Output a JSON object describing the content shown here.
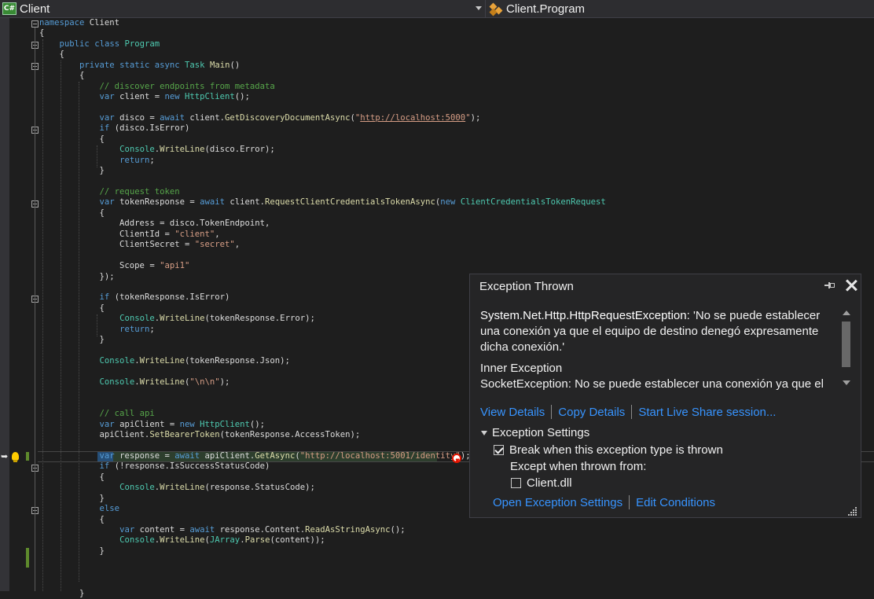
{
  "navbar": {
    "project_icon_label": "C#",
    "project": "Client",
    "member": "Client.Program"
  },
  "code_lines": [
    {
      "segs": [
        [
          "kw",
          "namespace"
        ],
        [
          "t",
          " Client"
        ]
      ]
    },
    {
      "segs": [
        [
          "t",
          "{"
        ]
      ]
    },
    {
      "segs": [
        [
          "t",
          "    "
        ],
        [
          "kw",
          "public"
        ],
        [
          "t",
          " "
        ],
        [
          "kw",
          "class"
        ],
        [
          "t",
          " "
        ],
        [
          "ty",
          "Program"
        ]
      ]
    },
    {
      "segs": [
        [
          "t",
          "    {"
        ]
      ]
    },
    {
      "segs": [
        [
          "t",
          "        "
        ],
        [
          "kw",
          "private"
        ],
        [
          "t",
          " "
        ],
        [
          "kw",
          "static"
        ],
        [
          "t",
          " "
        ],
        [
          "kw",
          "async"
        ],
        [
          "t",
          " "
        ],
        [
          "ty",
          "Task"
        ],
        [
          "t",
          " "
        ],
        [
          "fn",
          "Main"
        ],
        [
          "t",
          "()"
        ]
      ]
    },
    {
      "segs": [
        [
          "t",
          "        {"
        ]
      ]
    },
    {
      "segs": [
        [
          "t",
          "            "
        ],
        [
          "cm",
          "// discover endpoints from metadata"
        ]
      ]
    },
    {
      "segs": [
        [
          "t",
          "            "
        ],
        [
          "kw",
          "var"
        ],
        [
          "t",
          " client = "
        ],
        [
          "kw",
          "new"
        ],
        [
          "t",
          " "
        ],
        [
          "ty",
          "HttpClient"
        ],
        [
          "t",
          "();"
        ]
      ]
    },
    {
      "segs": [
        [
          "t",
          ""
        ]
      ]
    },
    {
      "segs": [
        [
          "t",
          "            "
        ],
        [
          "kw",
          "var"
        ],
        [
          "t",
          " disco = "
        ],
        [
          "kw",
          "await"
        ],
        [
          "t",
          " client."
        ],
        [
          "fn",
          "GetDiscoveryDocumentAsync"
        ],
        [
          "t",
          "("
        ],
        [
          "st",
          "\""
        ],
        [
          "url",
          "http://localhost:5000"
        ],
        [
          "st",
          "\""
        ],
        [
          "t",
          ");"
        ]
      ]
    },
    {
      "segs": [
        [
          "t",
          "            "
        ],
        [
          "kw",
          "if"
        ],
        [
          "t",
          " (disco.IsError)"
        ]
      ]
    },
    {
      "segs": [
        [
          "t",
          "            {"
        ]
      ]
    },
    {
      "segs": [
        [
          "t",
          "                "
        ],
        [
          "ty",
          "Console"
        ],
        [
          "t",
          "."
        ],
        [
          "fn",
          "WriteLine"
        ],
        [
          "t",
          "(disco.Error);"
        ]
      ]
    },
    {
      "segs": [
        [
          "t",
          "                "
        ],
        [
          "kw",
          "return"
        ],
        [
          "t",
          ";"
        ]
      ]
    },
    {
      "segs": [
        [
          "t",
          "            }"
        ]
      ]
    },
    {
      "segs": [
        [
          "t",
          ""
        ]
      ]
    },
    {
      "segs": [
        [
          "t",
          "            "
        ],
        [
          "cm",
          "// request token"
        ]
      ]
    },
    {
      "segs": [
        [
          "t",
          "            "
        ],
        [
          "kw",
          "var"
        ],
        [
          "t",
          " tokenResponse = "
        ],
        [
          "kw",
          "await"
        ],
        [
          "t",
          " client."
        ],
        [
          "fn",
          "RequestClientCredentialsTokenAsync"
        ],
        [
          "t",
          "("
        ],
        [
          "kw",
          "new"
        ],
        [
          "t",
          " "
        ],
        [
          "ty",
          "ClientCredentialsTokenRequest"
        ]
      ]
    },
    {
      "segs": [
        [
          "t",
          "            {"
        ]
      ]
    },
    {
      "segs": [
        [
          "t",
          "                Address = disco.TokenEndpoint,"
        ]
      ]
    },
    {
      "segs": [
        [
          "t",
          "                ClientId = "
        ],
        [
          "st",
          "\"client\""
        ],
        [
          "t",
          ","
        ]
      ]
    },
    {
      "segs": [
        [
          "t",
          "                ClientSecret = "
        ],
        [
          "st",
          "\"secret\""
        ],
        [
          "t",
          ","
        ]
      ]
    },
    {
      "segs": [
        [
          "t",
          ""
        ]
      ]
    },
    {
      "segs": [
        [
          "t",
          "                Scope = "
        ],
        [
          "st",
          "\"api1\""
        ]
      ]
    },
    {
      "segs": [
        [
          "t",
          "            });"
        ]
      ]
    },
    {
      "segs": [
        [
          "t",
          ""
        ]
      ]
    },
    {
      "segs": [
        [
          "t",
          "            "
        ],
        [
          "kw",
          "if"
        ],
        [
          "t",
          " (tokenResponse.IsError)"
        ]
      ]
    },
    {
      "segs": [
        [
          "t",
          "            {"
        ]
      ]
    },
    {
      "segs": [
        [
          "t",
          "                "
        ],
        [
          "ty",
          "Console"
        ],
        [
          "t",
          "."
        ],
        [
          "fn",
          "WriteLine"
        ],
        [
          "t",
          "(tokenResponse.Error);"
        ]
      ]
    },
    {
      "segs": [
        [
          "t",
          "                "
        ],
        [
          "kw",
          "return"
        ],
        [
          "t",
          ";"
        ]
      ]
    },
    {
      "segs": [
        [
          "t",
          "            }"
        ]
      ]
    },
    {
      "segs": [
        [
          "t",
          ""
        ]
      ]
    },
    {
      "segs": [
        [
          "t",
          "            "
        ],
        [
          "ty",
          "Console"
        ],
        [
          "t",
          "."
        ],
        [
          "fn",
          "WriteLine"
        ],
        [
          "t",
          "(tokenResponse.Json);"
        ]
      ]
    },
    {
      "segs": [
        [
          "t",
          ""
        ]
      ]
    },
    {
      "segs": [
        [
          "t",
          "            "
        ],
        [
          "ty",
          "Console"
        ],
        [
          "t",
          "."
        ],
        [
          "fn",
          "WriteLine"
        ],
        [
          "t",
          "("
        ],
        [
          "st",
          "\"\\n\\n\""
        ],
        [
          "t",
          ");"
        ]
      ]
    },
    {
      "segs": [
        [
          "t",
          ""
        ]
      ]
    },
    {
      "segs": [
        [
          "t",
          ""
        ]
      ]
    },
    {
      "segs": [
        [
          "t",
          "            "
        ],
        [
          "cm",
          "// call api"
        ]
      ]
    },
    {
      "segs": [
        [
          "t",
          "            "
        ],
        [
          "kw",
          "var"
        ],
        [
          "t",
          " apiClient = "
        ],
        [
          "kw",
          "new"
        ],
        [
          "t",
          " "
        ],
        [
          "ty",
          "HttpClient"
        ],
        [
          "t",
          "();"
        ]
      ]
    },
    {
      "segs": [
        [
          "t",
          "            apiClient."
        ],
        [
          "fn",
          "SetBearerToken"
        ],
        [
          "t",
          "(tokenResponse.AccessToken);"
        ]
      ]
    },
    {
      "segs": [
        [
          "t",
          ""
        ]
      ]
    },
    {
      "segs": [
        [
          "t",
          "            "
        ],
        [
          "kw",
          "var"
        ],
        [
          "t",
          " response = "
        ],
        [
          "kw",
          "await"
        ],
        [
          "t",
          " apiClient."
        ],
        [
          "fn",
          "GetAsync"
        ],
        [
          "t",
          "("
        ],
        [
          "st",
          "\"http://localhost:5001/identity\""
        ],
        [
          "t",
          ");"
        ]
      ]
    },
    {
      "segs": [
        [
          "t",
          "            "
        ],
        [
          "kw",
          "if"
        ],
        [
          "t",
          " (!response.IsSuccessStatusCode)"
        ]
      ]
    },
    {
      "segs": [
        [
          "t",
          "            {"
        ]
      ]
    },
    {
      "segs": [
        [
          "t",
          "                "
        ],
        [
          "ty",
          "Console"
        ],
        [
          "t",
          "."
        ],
        [
          "fn",
          "WriteLine"
        ],
        [
          "t",
          "(response.StatusCode);"
        ]
      ]
    },
    {
      "segs": [
        [
          "t",
          "            }"
        ]
      ]
    },
    {
      "segs": [
        [
          "t",
          "            "
        ],
        [
          "kw",
          "else"
        ]
      ]
    },
    {
      "segs": [
        [
          "t",
          "            {"
        ]
      ]
    },
    {
      "segs": [
        [
          "t",
          "                "
        ],
        [
          "kw",
          "var"
        ],
        [
          "t",
          " content = "
        ],
        [
          "kw",
          "await"
        ],
        [
          "t",
          " response.Content."
        ],
        [
          "fn",
          "ReadAsStringAsync"
        ],
        [
          "t",
          "();"
        ]
      ]
    },
    {
      "segs": [
        [
          "t",
          "                "
        ],
        [
          "ty",
          "Console"
        ],
        [
          "t",
          "."
        ],
        [
          "fn",
          "WriteLine"
        ],
        [
          "t",
          "("
        ],
        [
          "ty",
          "JArray"
        ],
        [
          "t",
          "."
        ],
        [
          "fn",
          "Parse"
        ],
        [
          "t",
          "(content));"
        ]
      ]
    },
    {
      "segs": [
        [
          "t",
          "            }"
        ]
      ]
    },
    {
      "segs": [
        [
          "t",
          ""
        ]
      ]
    },
    {
      "segs": [
        [
          "t",
          ""
        ]
      ]
    },
    {
      "segs": [
        [
          "t",
          ""
        ]
      ]
    },
    {
      "segs": [
        [
          "t",
          "        }"
        ]
      ]
    }
  ],
  "exception": {
    "title": "Exception Thrown",
    "type": "System.Net.Http.HttpRequestException:",
    "message": " 'No se puede establecer una conexión ya que el equipo de destino denegó expresamente dicha conexión.'",
    "inner_title": "Inner Exception",
    "inner_text": "SocketException: No se puede establecer una conexión ya que el",
    "links": {
      "view_details": "View Details",
      "copy_details": "Copy Details",
      "live_share": "Start Live Share session..."
    },
    "settings": {
      "header": "Exception Settings",
      "break_label": "Break when this exception type is thrown",
      "break_checked": true,
      "except_from": "Except when thrown from:",
      "module_label": "Client.dll",
      "module_checked": false,
      "open_settings": "Open Exception Settings",
      "edit_conditions": "Edit Conditions"
    }
  }
}
